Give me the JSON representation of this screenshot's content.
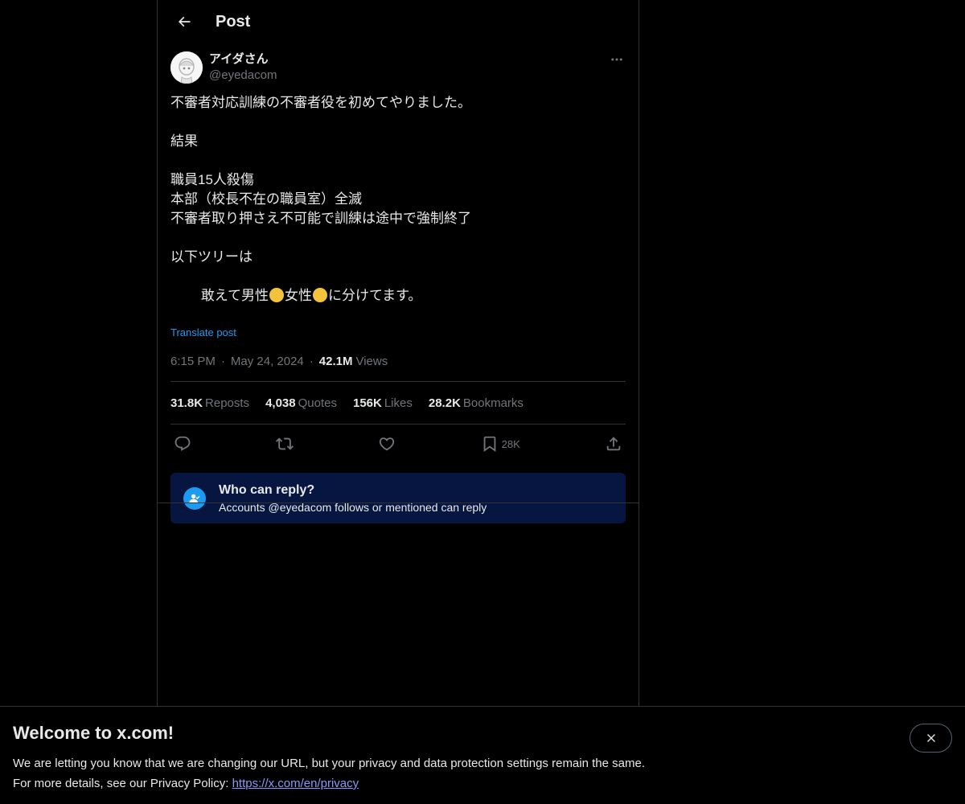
{
  "header": {
    "title": "Post"
  },
  "post": {
    "display_name": "アイダさん",
    "handle": "@eyedacom",
    "lines": [
      "不審者対応訓練の不審者役を初めてやりました。",
      "",
      "結果",
      "",
      "職員15人殺傷",
      "本部（校長不在の職員室）全滅",
      "不審者取り押さえ不可能で訓練は途中で強制終了",
      "",
      "以下ツリーは"
    ],
    "last_line": {
      "part1": "敢えて男性",
      "part2": "女性",
      "part3": "に分けてます。"
    },
    "translate_label": "Translate post",
    "time": "6:15 PM",
    "date": "May 24, 2024",
    "views_count": "42.1M",
    "views_label": "Views"
  },
  "stats": [
    {
      "num": "31.8K",
      "label": "Reposts"
    },
    {
      "num": "4,038",
      "label": "Quotes"
    },
    {
      "num": "156K",
      "label": "Likes"
    },
    {
      "num": "28.2K",
      "label": "Bookmarks"
    }
  ],
  "actions": {
    "bookmark_count": "28K"
  },
  "reply_restriction": {
    "title": "Who can reply?",
    "subtitle": "Accounts @eyedacom follows or mentioned can reply"
  },
  "banner": {
    "title": "Welcome to x.com!",
    "line1": "We are letting you know that we are changing our URL, but your privacy and data protection settings remain the same.",
    "line2_prefix": "For more details, see our Privacy Policy: ",
    "link": "https://x.com/en/privacy"
  },
  "icons": {
    "back": "arrow-left-icon",
    "more": "more-horizontal-icon",
    "reply": "speech-bubble-icon",
    "repost": "repost-icon",
    "like": "heart-icon",
    "bookmark": "bookmark-icon",
    "share": "share-icon",
    "who_can_reply": "person-check-icon",
    "close": "close-icon"
  },
  "colors": {
    "background": "#000000",
    "text": "#e7e9ea",
    "muted": "#71767b",
    "accent": "#1d9bf0",
    "reply_box": "#061640",
    "link": "#8b98f9"
  }
}
